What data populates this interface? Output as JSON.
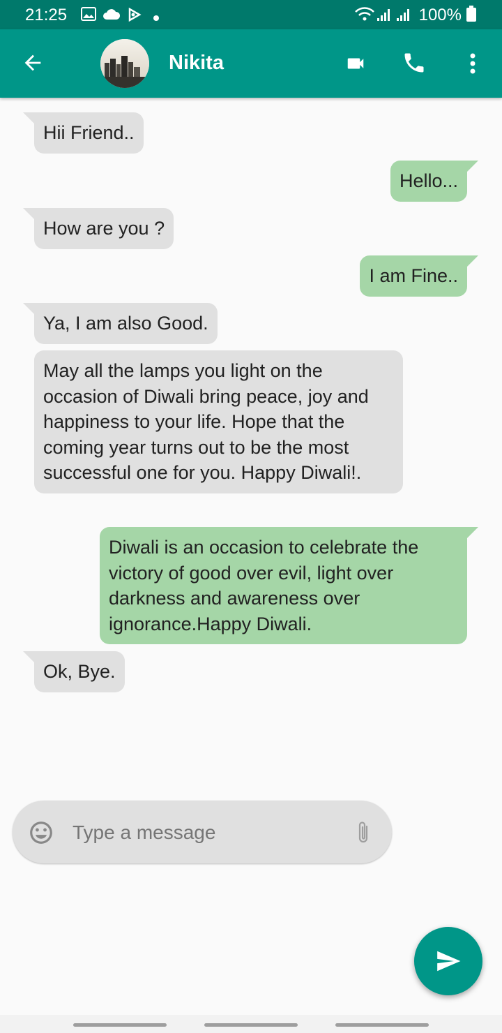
{
  "status_bar": {
    "time": "21:25",
    "battery": "100%"
  },
  "header": {
    "contact_name": "Nikita"
  },
  "messages": [
    {
      "dir": "in",
      "text": "Hii Friend.."
    },
    {
      "dir": "out",
      "text": "Hello..."
    },
    {
      "dir": "in",
      "text": "How are you ?"
    },
    {
      "dir": "out",
      "text": "I am Fine.."
    },
    {
      "dir": "in",
      "text": "Ya, I am also Good."
    },
    {
      "dir": "in",
      "text": "May all the lamps you light on the occasion of Diwali bring peace, joy and happiness to your life. Hope that the coming year turns out to be the most successful one for you. Happy Diwali!."
    },
    {
      "dir": "out",
      "text": "Diwali is an occasion to celebrate the victory of good over evil, light over darkness and awareness over ignorance.Happy Diwali."
    },
    {
      "dir": "in",
      "text": "Ok, Bye."
    }
  ],
  "composer": {
    "placeholder": "Type a message",
    "value": ""
  },
  "colors": {
    "primary": "#009688",
    "primary_dark": "#00796b",
    "incoming_bubble": "#e0e0e0",
    "outgoing_bubble": "#a5d6a7"
  },
  "icons": [
    "back-arrow-icon",
    "video-call-icon",
    "phone-icon",
    "more-vert-icon",
    "emoji-icon",
    "attach-icon",
    "send-icon"
  ]
}
